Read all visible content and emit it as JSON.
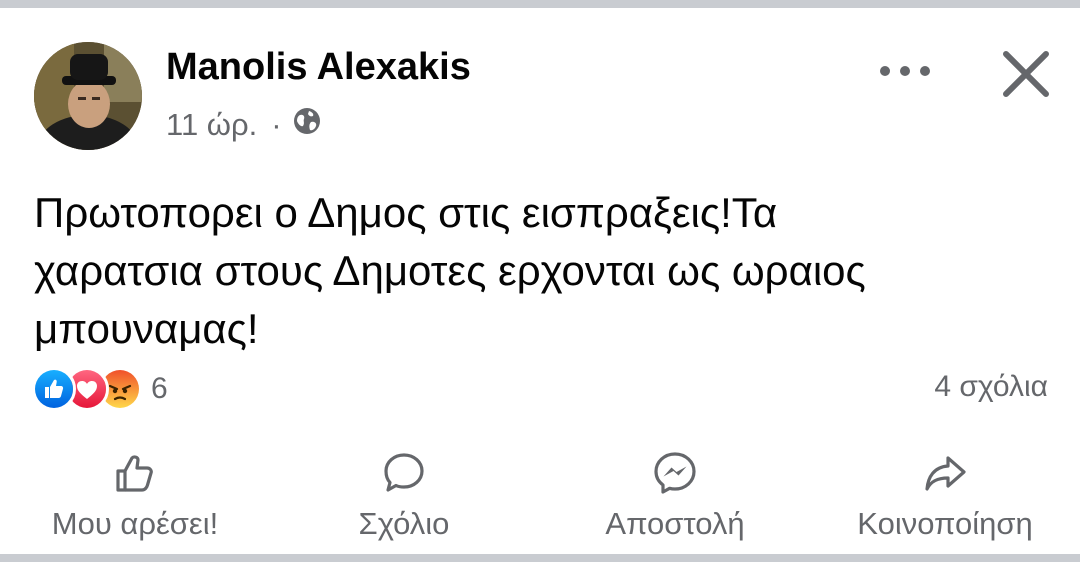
{
  "post": {
    "author": "Manolis Alexakis",
    "time": "11 ώρ.",
    "separator": "·",
    "audience_icon": "globe-icon",
    "text_lines": [
      "Πρωτοπορει ο Δημος στις εισπραξεις!Τα",
      "χαρατσια στους Δημοτες ερχονται ως ωραιος",
      "μπουναμας!"
    ]
  },
  "reactions": {
    "icons": [
      "like-reaction-icon",
      "love-reaction-icon",
      "angry-reaction-icon"
    ],
    "count": "6"
  },
  "comments": {
    "count_label": "4 σχόλια"
  },
  "actions": {
    "like": "Μου αρέσει!",
    "comment": "Σχόλιο",
    "send": "Αποστολή",
    "share": "Κοινοποίηση"
  },
  "colors": {
    "like_blue": "#1877f2",
    "love_red": "#f33e58",
    "angry_orange": "#f5703c",
    "secondary_text": "#65676b",
    "primary_text": "#050505"
  }
}
